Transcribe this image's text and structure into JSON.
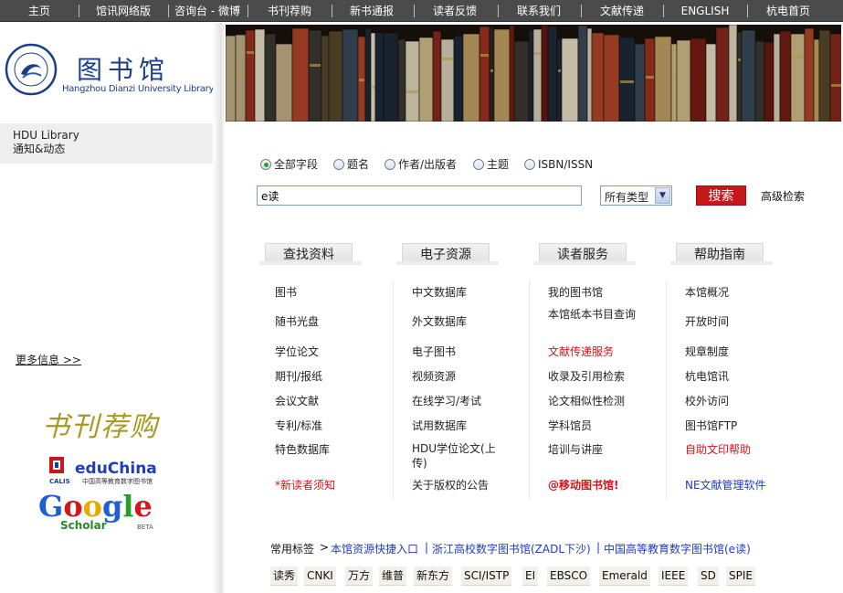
{
  "topnav": [
    "主页",
    "馆讯网络版",
    "咨询台 - 微博",
    "书刊荐购",
    "新书通报",
    "读者反馈",
    "联系我们",
    "文献传递",
    "ENGLISH",
    "杭电首页"
  ],
  "logo": {
    "title": "图书馆",
    "subtitle": "Hangzhou Dianzi University Library"
  },
  "notice": {
    "en": "HDU Library",
    "cn": "通知&动态"
  },
  "sidebar": {
    "more_info": "更多信息 >>",
    "recommend": "书刊荐购",
    "educhina": {
      "brand": "eduChina",
      "calis": "CALIS",
      "desc": "中国高等教育数字图书馆"
    },
    "google": {
      "brand": "Google",
      "sub": "Scholar",
      "beta": "BETA"
    }
  },
  "search": {
    "options": [
      {
        "label": "全部字段",
        "checked": true
      },
      {
        "label": "题名",
        "checked": false
      },
      {
        "label": "作者/出版者",
        "checked": false
      },
      {
        "label": "主题",
        "checked": false
      },
      {
        "label": "ISBN/ISSN",
        "checked": false
      }
    ],
    "query": "e读",
    "type_value": "所有类型",
    "button": "搜索",
    "advanced": "高级检索"
  },
  "categories": [
    {
      "tab": "查找资料",
      "links": [
        {
          "text": "图书"
        },
        {
          "text": "随书光盘"
        },
        {
          "text": "学位论文"
        },
        {
          "text": "期刊/报纸"
        },
        {
          "text": "会议文献"
        },
        {
          "text": "专利/标准"
        },
        {
          "text": "特色数据库"
        },
        {
          "text": "*新读者须知",
          "style": "red"
        }
      ]
    },
    {
      "tab": "电子资源",
      "links": [
        {
          "text": "中文数据库"
        },
        {
          "text": "外文数据库"
        },
        {
          "text": "电子图书"
        },
        {
          "text": "视频资源"
        },
        {
          "text": "在线学习/考试"
        },
        {
          "text": "试用数据库"
        },
        {
          "text": "HDU学位论文(上传)"
        },
        {
          "text": "关于版权的公告"
        }
      ]
    },
    {
      "tab": "读者服务",
      "links": [
        {
          "text": "我的图书馆"
        },
        {
          "text": "本馆纸本书目查询"
        },
        {
          "text": "文献传递服务",
          "style": "red"
        },
        {
          "text": "收录及引用检索"
        },
        {
          "text": "论文相似性检测"
        },
        {
          "text": "学科馆员"
        },
        {
          "text": "培训与讲座"
        },
        {
          "text": "@移动图书馆!",
          "style": "red-bold"
        }
      ]
    },
    {
      "tab": "帮助指南",
      "links": [
        {
          "text": "本馆概况"
        },
        {
          "text": "开放时间"
        },
        {
          "text": "规章制度"
        },
        {
          "text": "杭电馆讯"
        },
        {
          "text": "校外访问"
        },
        {
          "text": "图书馆FTP"
        },
        {
          "text": "自助文印帮助",
          "style": "red"
        },
        {
          "text": "NE文献管理软件",
          "style": "blue"
        }
      ]
    }
  ],
  "tags": {
    "label": "常用标签",
    "arrow": ">",
    "quick_links": [
      "本馆资源快捷入口",
      "浙江高校数字图书馆(ZADL下沙)",
      "中国高等教育数字图书馆(e读)"
    ],
    "separator": "|",
    "databases": [
      "读秀",
      "CNKI",
      "万方",
      "维普",
      "新东方",
      "SCI/ISTP",
      "EI",
      "EBSCO",
      "Emerald",
      "IEEE",
      "SD",
      "SPIE"
    ]
  },
  "colors": {
    "nav_bg": "#4b4b4b",
    "logo_blue": "#1b3e8c",
    "search_red": "#c8171b",
    "link_red": "#d6141a",
    "link_blue": "#1f3dbd",
    "recommend_gold": "#a79a1a"
  }
}
